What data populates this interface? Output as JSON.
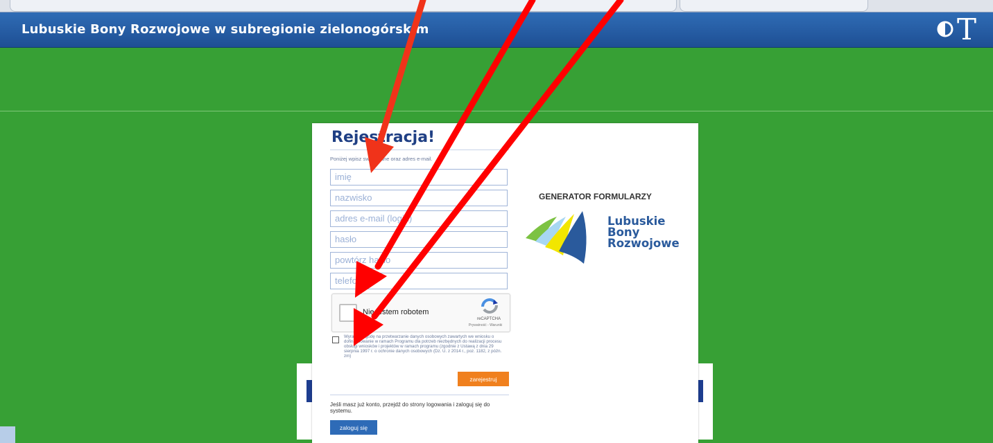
{
  "header": {
    "title": "Lubuskie Bony Rozwojowe w subregionie zielonogórskim",
    "contrast_icon": "contrast-icon",
    "glyph": "T"
  },
  "form": {
    "heading": "Rejestracja!",
    "intro": "Poniżej wpisz swoje dane oraz adres e-mail.",
    "fields": [
      {
        "placeholder": "imię"
      },
      {
        "placeholder": "nazwisko"
      },
      {
        "placeholder": "adres e-mail (login)"
      },
      {
        "placeholder": "hasło"
      },
      {
        "placeholder": "powtórz hasło"
      },
      {
        "placeholder": "telefon"
      }
    ],
    "captcha": {
      "label": "Nie jestem robotem",
      "brand": "reCAPTCHA",
      "terms": "Prywatność - Warunki"
    },
    "consent": "Wyrażam zgodę na przetwarzanie danych osobowych zawartych we wniosku o dofinansowanie w ramach Programu dla potrzeb niezbędnych do realizacji procesu obsługi wniosków i projektów w ramach programu (zgodnie z Ustawą z dnia 29 sierpnia 1997 r. o ochronie danych osobowych (Dz. U. z 2014 r., poz. 1182, z późn. zm)",
    "register_label": "zarejestruj",
    "account_text": "Jeśli masz już konto, przejdź do strony logowania i zaloguj się do systemu.",
    "login_label": "zaloguj się"
  },
  "brand": {
    "generator_title": "GENERATOR FORMULARZY",
    "line1": "Lubuskie",
    "line2": "Bony",
    "line3": "Rozwojowe"
  },
  "colors": {
    "background": "#37a035",
    "header": "#1e4f94",
    "register_button": "#f0801e",
    "login_button": "#2e6bb7",
    "annotation_arrows": "#ff0000"
  }
}
